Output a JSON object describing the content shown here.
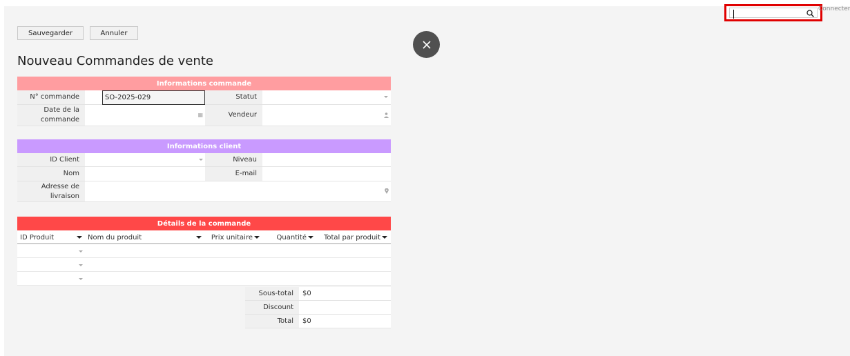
{
  "header": {
    "search_value": "",
    "login_link": "Connecter"
  },
  "toolbar": {
    "save_label": "Sauvegarder",
    "cancel_label": "Annuler"
  },
  "page": {
    "title": "Nouveau Commandes de vente"
  },
  "order_info": {
    "title": "Informations commande",
    "color": "#ff9da0",
    "order_number_label": "N° commande",
    "order_number_value": "SO-2025-029",
    "status_label": "Statut",
    "date_label": "Date de la commande",
    "seller_label": "Vendeur"
  },
  "client_info": {
    "title": "Informations client",
    "color": "#c99aff",
    "client_id_label": "ID Client",
    "level_label": "Niveau",
    "name_label": "Nom",
    "email_label": "E-mail",
    "address_label": "Adresse de livraison"
  },
  "order_details": {
    "title": "Détails de la commande",
    "color": "#ff4848",
    "columns": [
      "ID Produit",
      "Nom du produit",
      "Prix unitaire",
      "Quantité",
      "Total par produit"
    ],
    "rows": 3
  },
  "totals": {
    "subtotal_label": "Sous-total",
    "subtotal_value": "$0",
    "discount_label": "Discount",
    "discount_value": "",
    "total_label": "Total",
    "total_value": "$0"
  },
  "colors": {
    "highlight": "#e00000",
    "close_button": "#505050"
  }
}
